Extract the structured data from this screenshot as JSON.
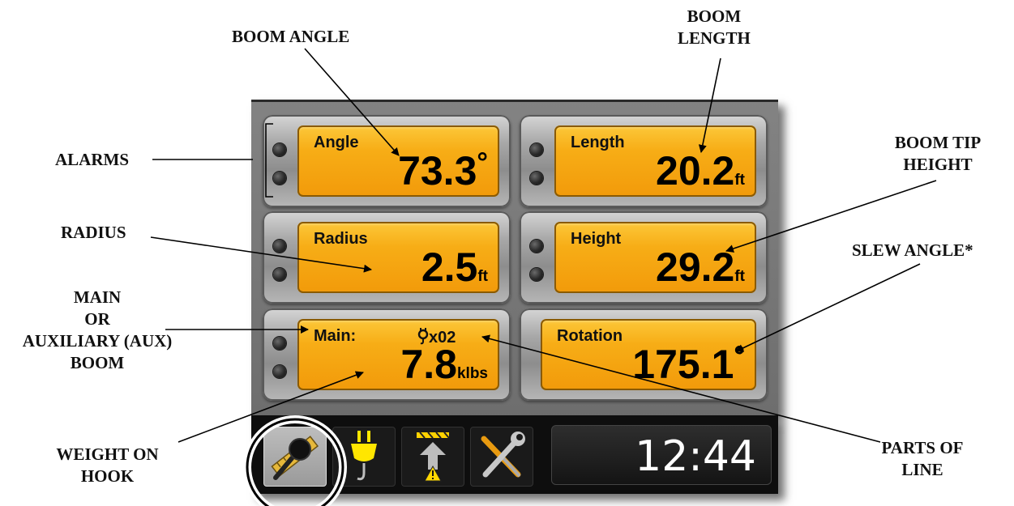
{
  "callouts": {
    "boom_angle": [
      "BOOM ANGLE"
    ],
    "boom_length": [
      "BOOM",
      "LENGTH"
    ],
    "alarms": [
      "ALARMS"
    ],
    "radius": [
      "RADIUS"
    ],
    "main_aux": [
      "MAIN",
      "OR",
      "AUXILIARY (AUX)",
      "BOOM"
    ],
    "boom_tip_height": [
      "BOOM TIP",
      "HEIGHT"
    ],
    "slew_angle": [
      "SLEW ANGLE*"
    ],
    "weight_on_hook": [
      "WEIGHT ON",
      "HOOK"
    ],
    "parts_of_line": [
      "PARTS OF",
      "LINE"
    ]
  },
  "tiles": {
    "angle": {
      "label": "Angle",
      "value": "73.3",
      "unit": "°"
    },
    "length": {
      "label": "Length",
      "value": "20.2",
      "unit": "ft"
    },
    "radius": {
      "label": "Radius",
      "value": "2.5",
      "unit": "ft"
    },
    "height": {
      "label": "Height",
      "value": "29.2",
      "unit": "ft"
    },
    "main": {
      "label": "Main:",
      "parts_of_line": "x02",
      "value": "7.8",
      "unit": "klbs"
    },
    "rotation": {
      "label": "Rotation",
      "value": "175.1",
      "unit": "°"
    }
  },
  "taskbar": {
    "buttons": [
      {
        "name": "measure-tools",
        "icon": "ruler-magnifier-icon",
        "selected": true
      },
      {
        "name": "hook",
        "icon": "hook-icon",
        "selected": false
      },
      {
        "name": "height-limit-warning",
        "icon": "height-warning-icon",
        "selected": false
      },
      {
        "name": "settings-tools",
        "icon": "wrench-screwdriver-icon",
        "selected": false
      }
    ],
    "time": "12:44"
  },
  "colors": {
    "panel_yellow": "#f7ad16",
    "screen_gray": "#7a7a7a",
    "taskbar_black": "#0e0e0e",
    "clock_text": "#ffffff",
    "warning_yellow": "#ffd700"
  }
}
